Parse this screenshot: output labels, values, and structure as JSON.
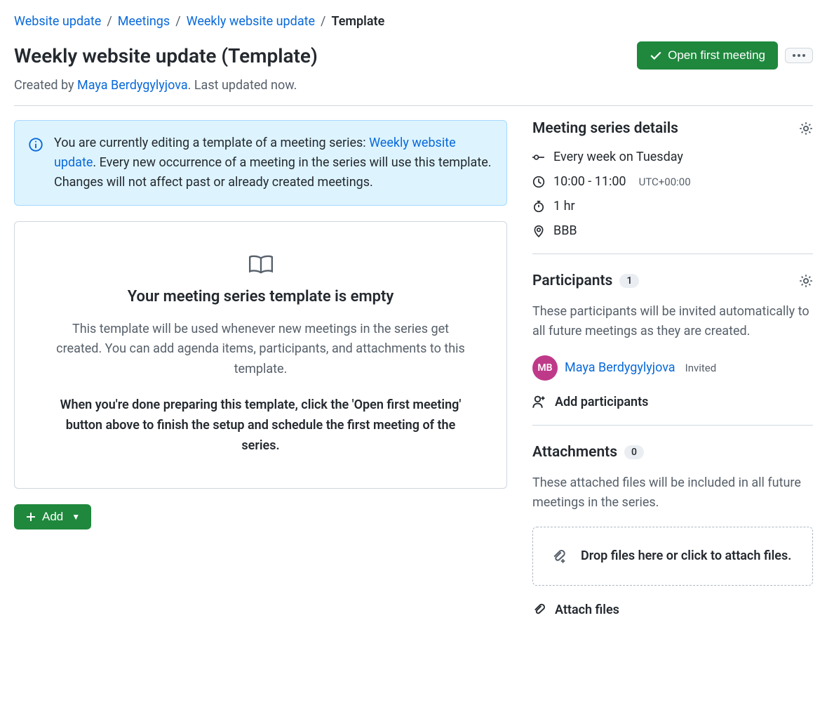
{
  "breadcrumb": {
    "items": [
      {
        "label": "Website update"
      },
      {
        "label": "Meetings"
      },
      {
        "label": "Weekly website update"
      }
    ],
    "current": "Template"
  },
  "header": {
    "title": "Weekly website update (Template)",
    "open_button": "Open first meeting"
  },
  "meta": {
    "created_by_prefix": "Created by ",
    "author": "Maya Berdygylyjova",
    "updated_suffix": ". Last updated now."
  },
  "alert": {
    "text_before_link": "You are currently editing a template of a meeting series: ",
    "link": "Weekly website update",
    "text_after_link": ". Every new occurrence of a meeting in the series will use this template. Changes will not affect past or already created meetings."
  },
  "empty": {
    "title": "Your meeting series template is empty",
    "desc": "This template will be used whenever new meetings in the series get created. You can add agenda items, participants, and attachments to this template.",
    "bold": "When you're done preparing this template, click the 'Open first meeting' button above to finish the setup and schedule the first meeting of the series."
  },
  "add_button": "Add",
  "details": {
    "title": "Meeting series details",
    "recurrence": "Every week on Tuesday",
    "time": "10:00 - 11:00",
    "timezone": "UTC+00:00",
    "duration": "1 hr",
    "location": "BBB"
  },
  "participants": {
    "title": "Participants",
    "count": "1",
    "desc": "These participants will be invited automatically to all future meetings as they are created.",
    "list": [
      {
        "initials": "MB",
        "name": "Maya Berdygylyjova",
        "status": "Invited"
      }
    ],
    "add_label": "Add participants"
  },
  "attachments": {
    "title": "Attachments",
    "count": "0",
    "desc": "These attached files will be included in all future meetings in the series.",
    "dropzone": "Drop files here or click to attach files.",
    "attach_label": "Attach files"
  }
}
